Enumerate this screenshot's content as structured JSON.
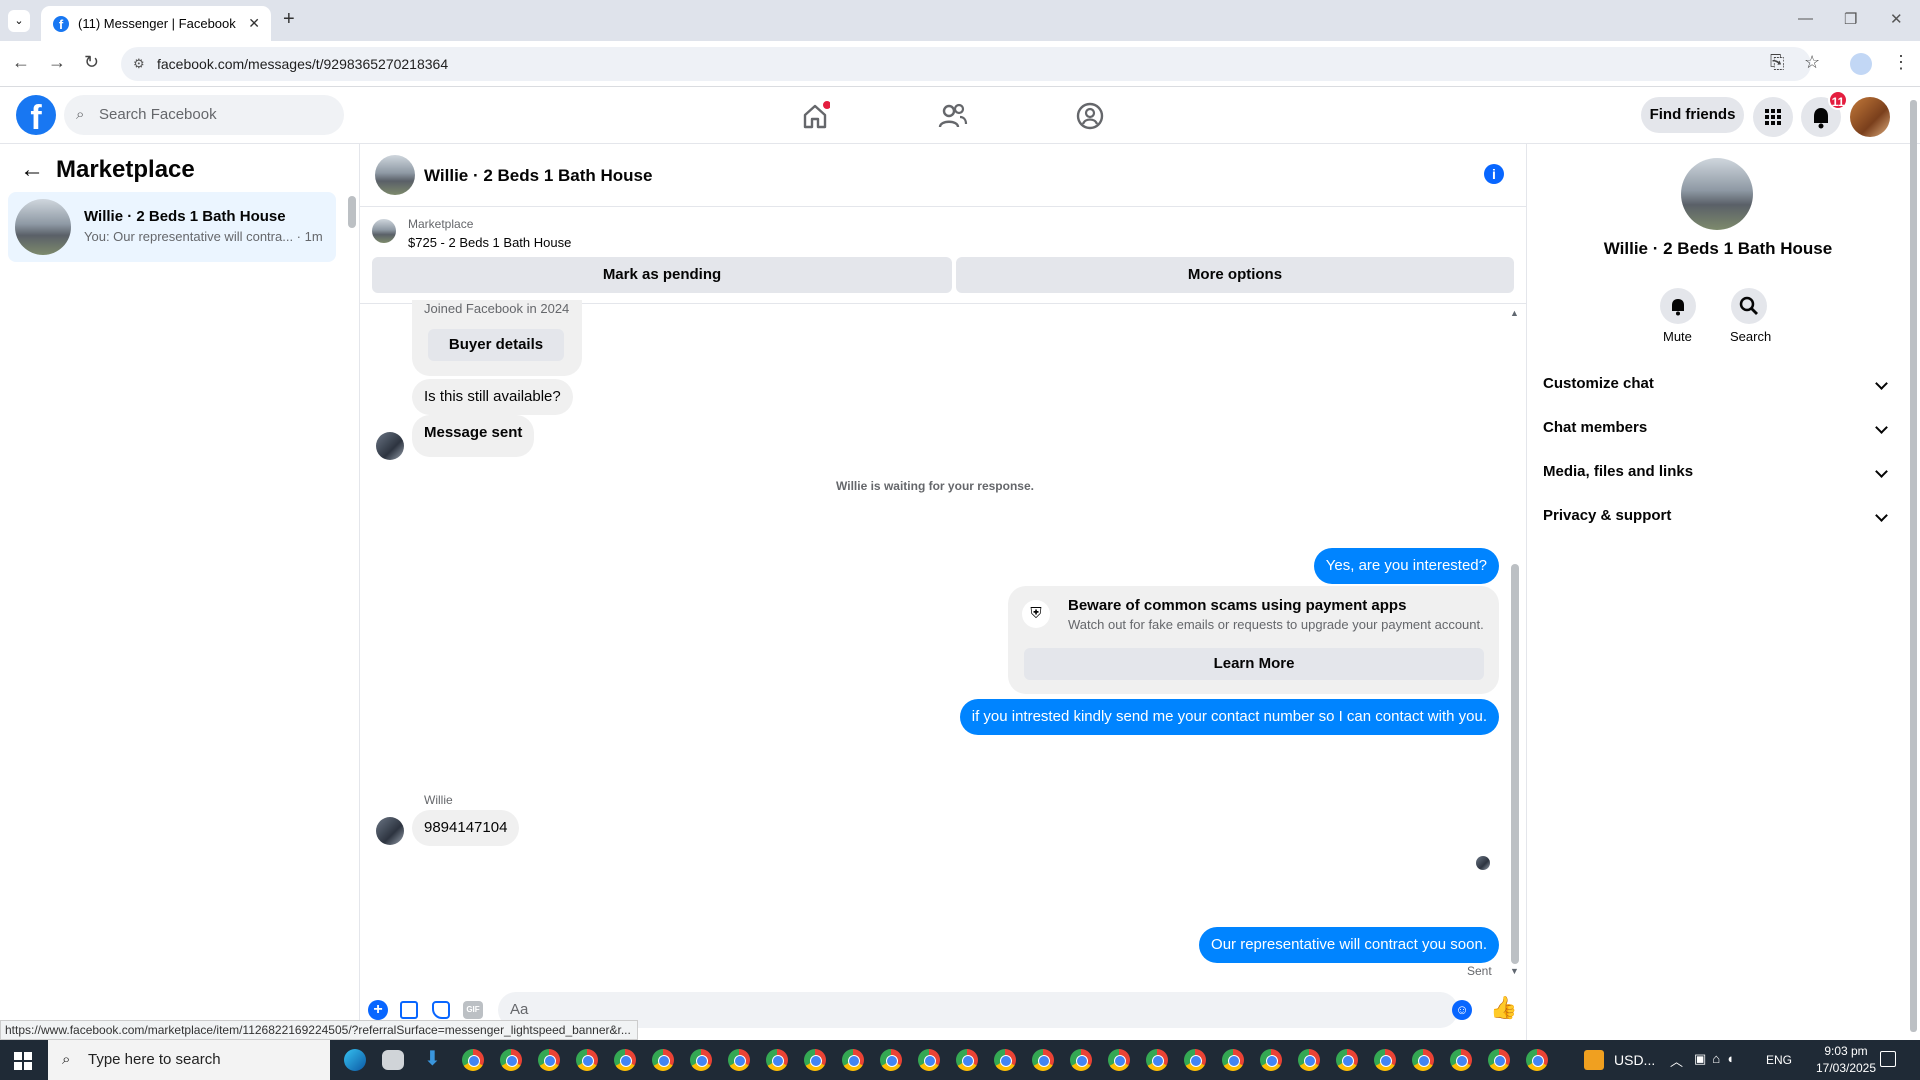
{
  "browser": {
    "tab_title": "(11) Messenger | Facebook",
    "url": "facebook.com/messages/t/9298365270218364",
    "status_url": "https://www.facebook.com/marketplace/item/1126822169224505/?referralSurface=messenger_lightspeed_banner&r..."
  },
  "fb_header": {
    "search_placeholder": "Search Facebook",
    "find_friends": "Find friends",
    "notification_count": "11"
  },
  "left": {
    "title": "Marketplace",
    "conversations": [
      {
        "title": "Willie · 2 Beds 1 Bath House",
        "preview": "You: Our representative will contra... · 1m"
      }
    ]
  },
  "chat": {
    "title": "Willie · 2 Beds 1 Bath House",
    "listing_label": "Marketplace",
    "listing_title": "$725 - 2 Beds 1 Bath House",
    "mark_pending": "Mark as pending",
    "more_options": "More options",
    "joined_text": "Joined Facebook in 2024",
    "buyer_details": "Buyer details",
    "msg_available": "Is this still available?",
    "msg_sent_label": "Message sent",
    "waiting_text": "Willie is waiting for your response.",
    "msg_interested": "Yes, are you interested?",
    "scam_title": "Beware of common scams using payment apps",
    "scam_body": "Watch out for fake emails or requests to upgrade your payment account.",
    "learn_more": "Learn More",
    "msg_contact": "if you intrested kindly send me your contact number so I can contact with you.",
    "sender_name": "Willie",
    "msg_number": "9894147104",
    "msg_rep": "Our representative will contract you soon.",
    "sent_label": "Sent",
    "composer_placeholder": "Aa"
  },
  "right": {
    "title": "Willie · 2 Beds 1 Bath House",
    "mute": "Mute",
    "search": "Search",
    "sections": [
      "Customize chat",
      "Chat members",
      "Media, files and links",
      "Privacy & support"
    ]
  },
  "taskbar": {
    "search_placeholder": "Type here to search",
    "currency": "USD...",
    "lang": "ENG",
    "time": "9:03 pm",
    "date": "17/03/2025"
  }
}
